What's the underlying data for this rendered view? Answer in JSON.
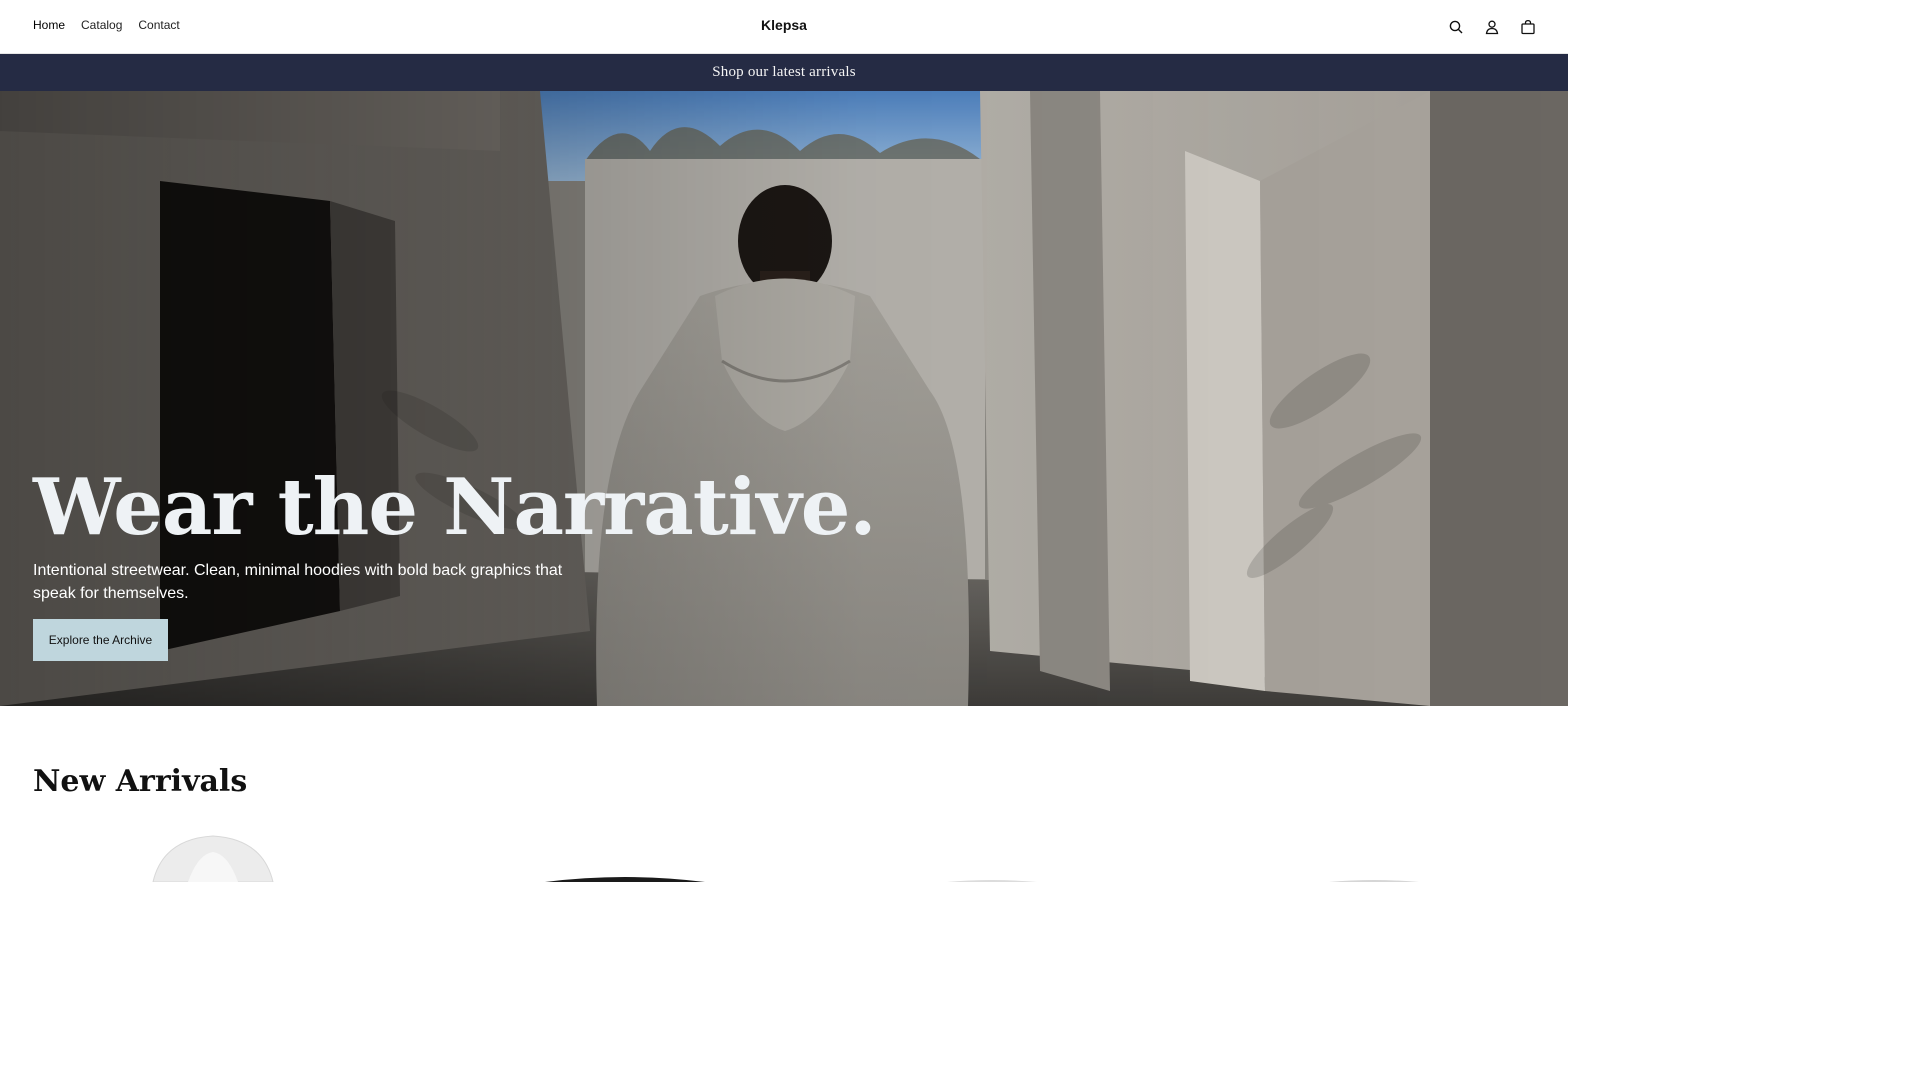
{
  "header": {
    "nav": [
      "Home",
      "Catalog",
      "Contact"
    ],
    "brand": "Klepsa",
    "icons": [
      "search-icon",
      "account-icon",
      "cart-icon"
    ]
  },
  "announcement": {
    "text": "Shop our latest arrivals",
    "background": "#252b44"
  },
  "hero": {
    "title": "Wear the Narrative.",
    "subtitle": "Intentional streetwear. Clean, minimal hoodies with bold back graphics that speak for themselves.",
    "cta_label": "Explore the Archive",
    "cta_color": "#bfd6dd"
  },
  "arrivals": {
    "title": "New Arrivals",
    "products": [
      {
        "color": "#f2f2f2"
      },
      {
        "color": "#1a1a1a"
      },
      {
        "color": "#e8e8e8"
      },
      {
        "color": "#e0e0e0"
      }
    ]
  }
}
